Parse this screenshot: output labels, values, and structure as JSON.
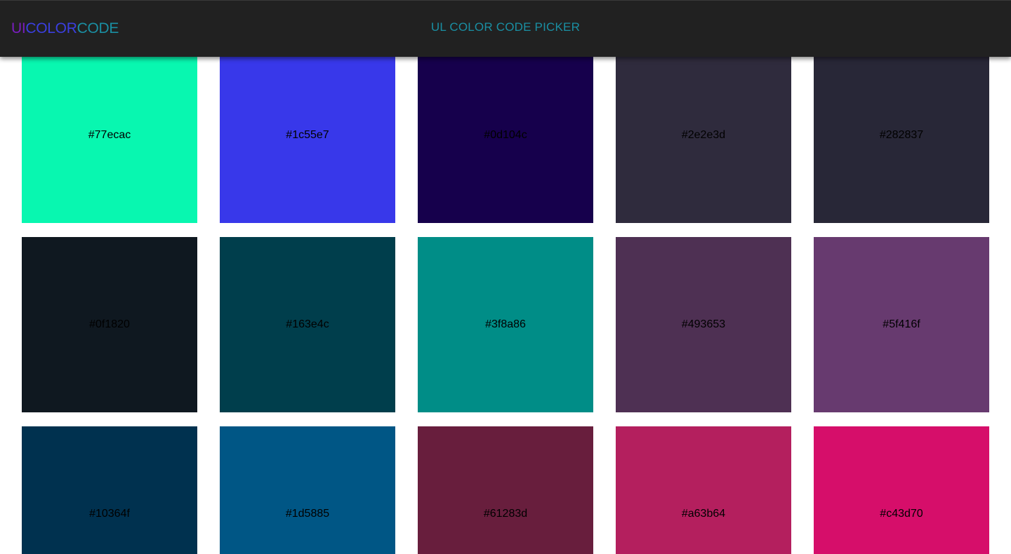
{
  "header": {
    "logo": {
      "part1": "UI",
      "part2": "COLOR",
      "part3": "CODE",
      "part1_color": "#7a1ec0",
      "part2_color": "#3b3fe0",
      "part3_color": "#1a8fa3"
    },
    "title": "UL COLOR CODE PICKER",
    "background": "#212121"
  },
  "swatches": [
    {
      "label": "#77ecac",
      "color": "#08f7b0"
    },
    {
      "label": "#1c55e7",
      "color": "#3838ea"
    },
    {
      "label": "#0d104c",
      "color": "#16004c"
    },
    {
      "label": "#2e2e3d",
      "color": "#2f2b3d"
    },
    {
      "label": "#282837",
      "color": "#282737"
    },
    {
      "label": "#0f1820",
      "color": "#0f1820"
    },
    {
      "label": "#163e4c",
      "color": "#003e4c"
    },
    {
      "label": "#3f8a86",
      "color": "#008d87"
    },
    {
      "label": "#493653",
      "color": "#4e3053"
    },
    {
      "label": "#5f416f",
      "color": "#673a6f"
    },
    {
      "label": "#10364f",
      "color": "#00314f"
    },
    {
      "label": "#1d5885",
      "color": "#005685"
    },
    {
      "label": "#61283d",
      "color": "#681e3d"
    },
    {
      "label": "#a63b64",
      "color": "#b41f5e"
    },
    {
      "label": "#c43d70",
      "color": "#d60e6a"
    }
  ]
}
